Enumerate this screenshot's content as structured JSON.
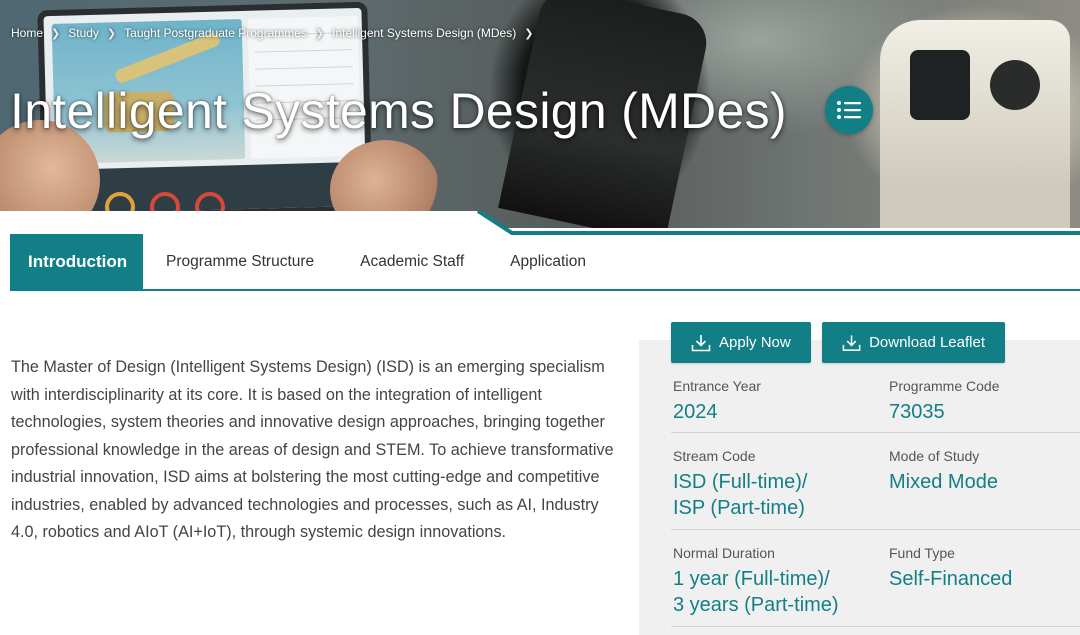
{
  "breadcrumb": {
    "items": [
      "Home",
      "Study",
      "Taught Postgraduate Programmes",
      "Intelligent Systems Design (MDes)"
    ]
  },
  "hero": {
    "title": "Intelligent Systems Design (MDes)",
    "menu_icon": "list-icon"
  },
  "tabs": [
    {
      "label": "Introduction",
      "active": true
    },
    {
      "label": "Programme Structure",
      "active": false
    },
    {
      "label": "Academic Staff",
      "active": false
    },
    {
      "label": "Application",
      "active": false
    }
  ],
  "intro": {
    "text": "The Master of Design (Intelligent Systems Design) (ISD) is an emerging specialism with interdisciplinarity at its core. It is based on the integration of intelligent technologies, system theories and innovative design approaches, bringing together professional knowledge in the areas of design and STEM. To achieve transformative industrial innovation, ISD aims at bolstering the most cutting-edge and competitive industries, enabled by advanced technologies and processes, such as AI, Industry 4.0, robotics and AIoT (AI+IoT), through systemic design innovations."
  },
  "actions": {
    "apply_label": "Apply Now",
    "leaflet_label": "Download Leaflet",
    "icon": "download-icon"
  },
  "info": {
    "entrance_year": {
      "label": "Entrance Year",
      "value": "2024"
    },
    "programme_code": {
      "label": "Programme Code",
      "value": "73035"
    },
    "stream_code": {
      "label": "Stream Code",
      "value_line1": "ISD (Full-time)/",
      "value_line2": "ISP (Part-time)"
    },
    "mode_of_study": {
      "label": "Mode of Study",
      "value": "Mixed Mode"
    },
    "normal_duration": {
      "label": "Normal Duration",
      "value_line1": "1 year (Full-time)/",
      "value_line2": "3 years (Part-time)"
    },
    "fund_type": {
      "label": "Fund Type",
      "value": "Self-Financed"
    }
  },
  "colors": {
    "brand_teal": "#127f86",
    "panel_bg": "#f0f0f0"
  }
}
